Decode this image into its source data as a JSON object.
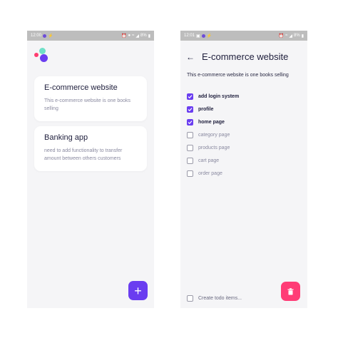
{
  "left_screen": {
    "status": {
      "time": "12:00",
      "battery": "8%"
    },
    "logo_text": "",
    "projects": [
      {
        "title": "E-commerce website",
        "description": "This e-commerce website is one books selling"
      },
      {
        "title": "Banking app",
        "description": "need to add functionality to transfer amount between others customers"
      }
    ],
    "fab_label": "+"
  },
  "right_screen": {
    "status": {
      "time": "12:01",
      "battery": "8%"
    },
    "title": "E-commerce website",
    "description": "This e-commerce website is one books selling",
    "todos": [
      {
        "label": "add login system",
        "checked": true
      },
      {
        "label": "profile",
        "checked": true
      },
      {
        "label": "home page",
        "checked": true
      },
      {
        "label": "category page",
        "checked": false
      },
      {
        "label": "products page",
        "checked": false
      },
      {
        "label": "cart page",
        "checked": false
      },
      {
        "label": "order page",
        "checked": false
      }
    ],
    "new_todo_placeholder": "Create todo items..."
  },
  "colors": {
    "accent": "#6a3df0",
    "danger": "#ff3c76",
    "logo_teal": "#6fe0c8",
    "logo_pink": "#ff3c6f"
  }
}
